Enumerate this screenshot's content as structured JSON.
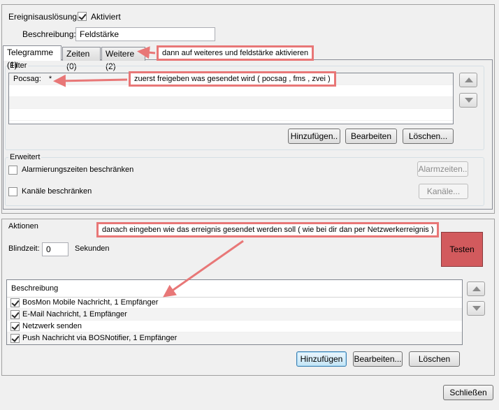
{
  "trigger": {
    "label": "Ereignisauslösung:",
    "activated_label": "Aktiviert",
    "activated": true,
    "description_label": "Beschreibung:",
    "description_value": "Feldstärke"
  },
  "tabs": [
    {
      "label": "Telegramme (1)",
      "active": true
    },
    {
      "label": "Zeiten (0)",
      "active": false
    },
    {
      "label": "Weitere (2)",
      "active": false
    }
  ],
  "filter": {
    "group_title": "Filter",
    "rows": [
      {
        "name": "Pocsag:",
        "value": "*"
      }
    ],
    "buttons": {
      "add": "Hinzufügen..",
      "edit": "Bearbeiten",
      "delete": "Löschen..."
    }
  },
  "extended": {
    "group_title": "Erweitert",
    "alarm_times_label": "Alarmierungszeiten beschränken",
    "alarm_times_checked": false,
    "alarm_times_button": "Alarmzeiten..",
    "channels_label": "Kanäle beschränken",
    "channels_checked": false,
    "channels_button": "Kanäle..."
  },
  "actions": {
    "group_title": "Aktionen",
    "blindzeit_label": "Blindzeit:",
    "blindzeit_value": "0",
    "seconds_label": "Sekunden",
    "test_button": "Testen",
    "list_header": "Beschreibung",
    "items": [
      {
        "label": "BosMon Mobile Nachricht, 1 Empfänger",
        "checked": true
      },
      {
        "label": "E-Mail Nachricht, 1 Empfänger",
        "checked": true
      },
      {
        "label": "Netzwerk senden",
        "checked": true
      },
      {
        "label": "Push Nachricht via BOSNotifier, 1 Empfänger",
        "checked": true
      }
    ],
    "buttons": {
      "add": "Hinzufügen",
      "edit": "Bearbeiten...",
      "delete": "Löschen"
    }
  },
  "close_button": "Schließen",
  "annotations": {
    "tab_note": "dann auf weiteres und feldstärke aktivieren",
    "filter_note": "zuerst freigeben was gesendet wird ( pocsag , fms , zvei )",
    "action_note": "danach eingeben wie das erreignis gesendet werden soll  ( wie bei dir dan per Netzwerkerreignis )"
  },
  "colors": {
    "annotation": "#e87777",
    "test_button": "#d25a5d"
  }
}
